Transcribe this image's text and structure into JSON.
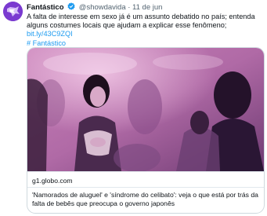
{
  "tweet": {
    "author_name": "Fantástico",
    "handle_time": "@showdavida · 11 de jun",
    "text": "A falta de interesse em sexo já é um assunto debatido no país; entenda alguns costumes locais que ajudam a explicar esse fenômeno; ",
    "link": "bit.ly/43C9ZQI",
    "hashtag": "# Fantástico"
  },
  "card": {
    "domain": "g1.globo.com",
    "title": "'Namorados de aluguel' e 'síndrome do celibato': veja o que está por trás da falta de bebês que preocupa o governo japonês"
  },
  "icons": {
    "avatar": "fantastico-logo-icon",
    "verified": "verified-badge-icon"
  },
  "colors": {
    "link": "#1d9bf0",
    "verified": "#1d9bf0",
    "avatar": "#7a3ad0"
  }
}
